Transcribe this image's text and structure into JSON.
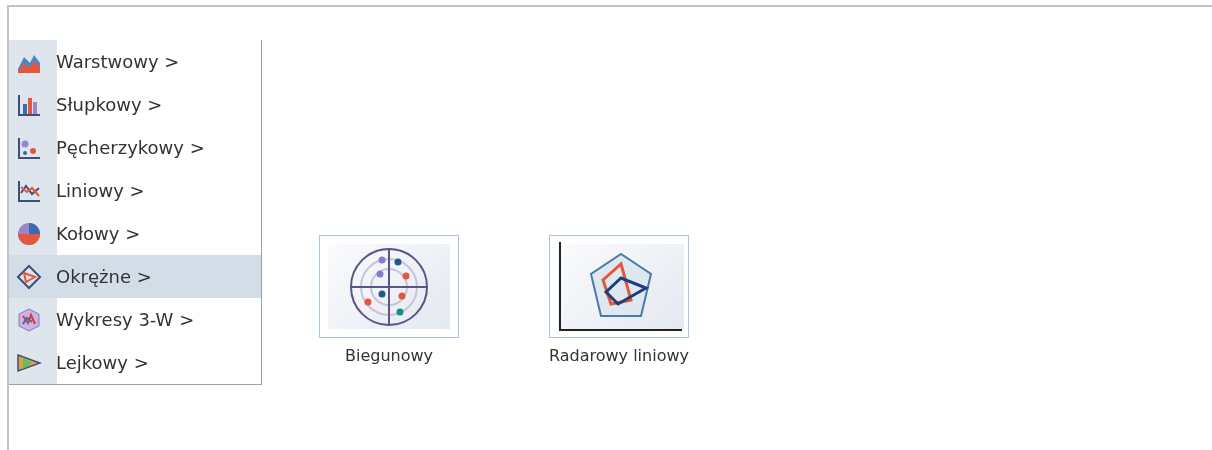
{
  "menu": {
    "items": [
      {
        "label": "Warstwowy >",
        "selected": false
      },
      {
        "label": "Słupkowy >",
        "selected": false
      },
      {
        "label": "Pęcherzykowy >",
        "selected": false
      },
      {
        "label": "Liniowy >",
        "selected": false
      },
      {
        "label": "Kołowy >",
        "selected": false
      },
      {
        "label": "Okrężne >",
        "selected": true
      },
      {
        "label": "Wykresy 3-W >",
        "selected": false
      },
      {
        "label": "Lejkowy >",
        "selected": false
      }
    ]
  },
  "gallery": {
    "items": [
      {
        "label": "Biegunowy"
      },
      {
        "label": "Radarowy liniowy"
      }
    ]
  }
}
